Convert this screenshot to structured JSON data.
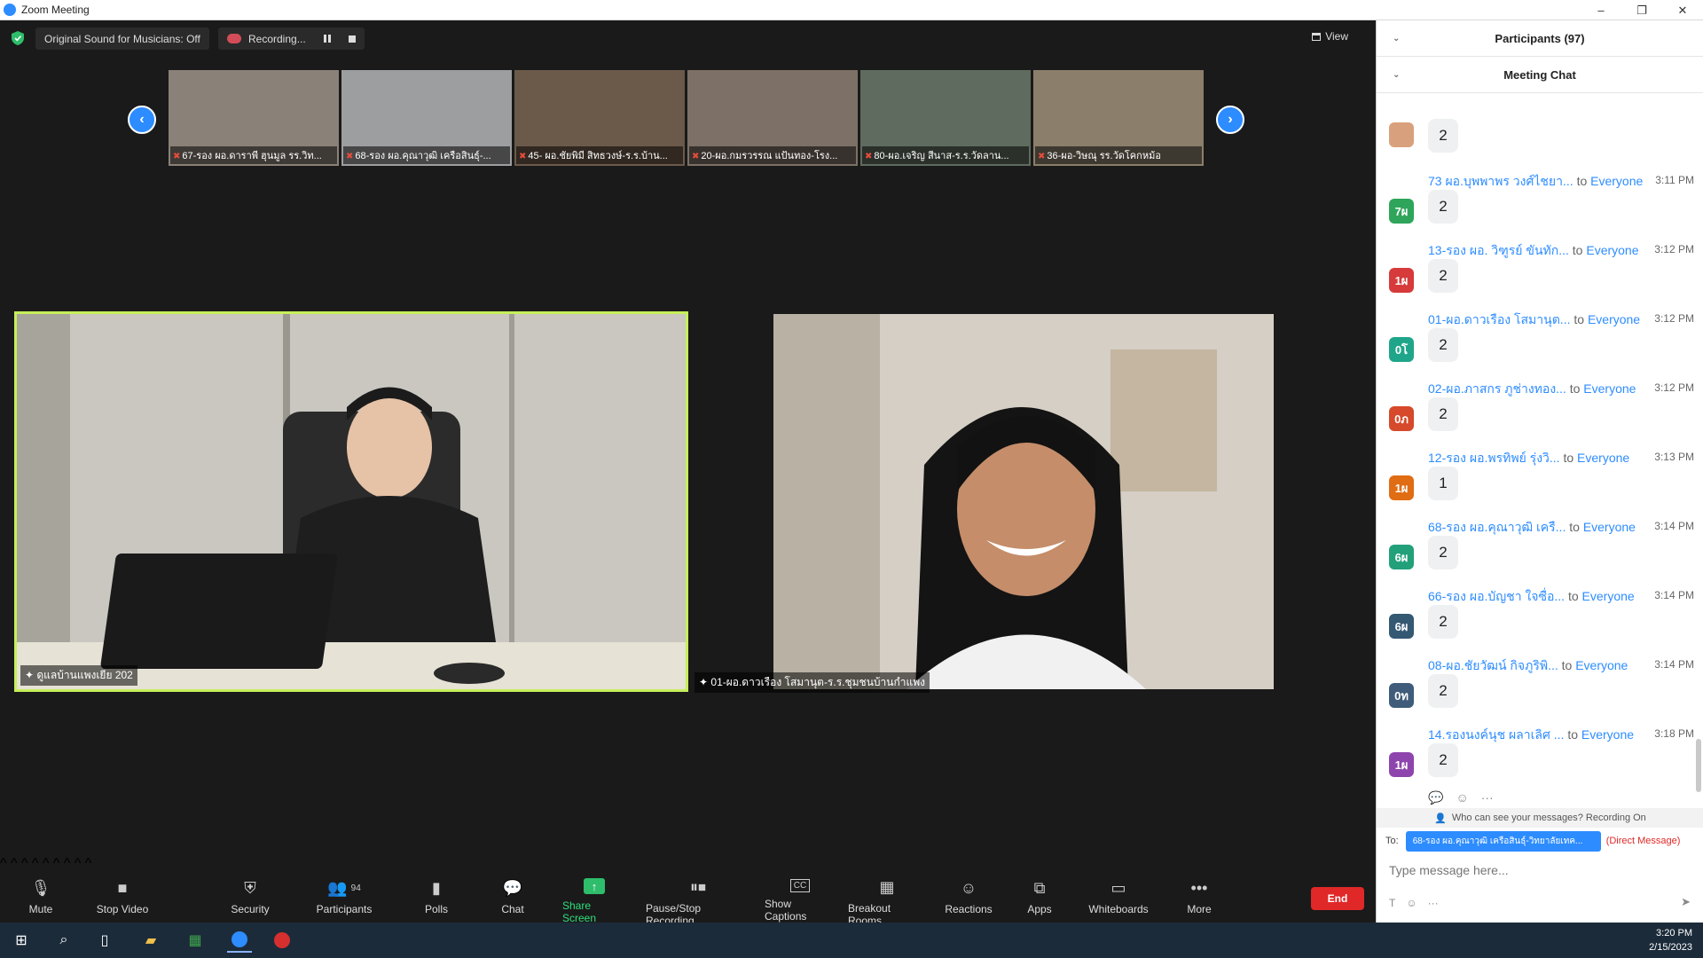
{
  "window": {
    "title": "Zoom Meeting",
    "controls": [
      "–",
      "❐",
      "✕"
    ]
  },
  "topbar": {
    "original_sound": "Original Sound for Musicians: Off",
    "recording": "Recording...",
    "view": "View"
  },
  "thumbnails": [
    {
      "name": "67-รอง ผอ.ดาราพี ฮุนมูล รร.วิท...",
      "color": "#8a8178"
    },
    {
      "name": "68-รอง ผอ.คุณาวุฒิ เครือสินธุ์-...",
      "color": "#9d9ea0"
    },
    {
      "name": "45- ผอ.ชัยพิมี สิทธวงษ์-ร.ร.บ้าน...",
      "color": "#6b5a4a"
    },
    {
      "name": "20-ผอ.กมรวรรณ แป้นทอง-โรง...",
      "color": "#7d7066"
    },
    {
      "name": "80-ผอ.เจริญ สีนาส-ร.ร.วัดลาน...",
      "color": "#5f6b5e"
    },
    {
      "name": "36-ผอ-วิษณุ รร.วัดโคกหม้อ",
      "color": "#8b7e6a"
    }
  ],
  "main_videos": {
    "main_label": "ดูแลบ้านแพงเยีย 202",
    "second_label": "01-ผอ.ดาวเรือง โสมานุต-ร.ร.ชุมชนบ้านกำแพง"
  },
  "toolbar": {
    "mute": "Mute",
    "stop_video": "Stop Video",
    "security": "Security",
    "participants": "Participants",
    "participants_count": "94",
    "polls": "Polls",
    "chat": "Chat",
    "share_screen": "Share Screen",
    "pause_stop_recording": "Pause/Stop Recording",
    "show_captions": "Show Captions",
    "breakout_rooms": "Breakout Rooms",
    "reactions": "Reactions",
    "apps": "Apps",
    "whiteboards": "Whiteboards",
    "more": "More",
    "end": "End",
    "cc_icon": "CC"
  },
  "panel": {
    "participants_header": "Participants (97)",
    "chat_header": "Meeting Chat",
    "first_message_value": "2",
    "messages": [
      {
        "sender": "73 ผอ.บุพพาพร วงศ์ไชยา...",
        "to": "to",
        "recipient": "Everyone",
        "time": "3:11 PM",
        "avatar": "7ผ",
        "avatar_color": "#2ea55a",
        "text": "2"
      },
      {
        "sender": "13-รอง ผอ. วิฑูรย์ ขันทัก...",
        "to": "to",
        "recipient": "Everyone",
        "time": "3:12 PM",
        "avatar": "1ผ",
        "avatar_color": "#d63a3a",
        "text": "2"
      },
      {
        "sender": "01-ผอ.ดาวเรือง โสมานุต...",
        "to": "to",
        "recipient": "Everyone",
        "time": "3:12 PM",
        "avatar": "0โ",
        "avatar_color": "#1fa58a",
        "text": "2"
      },
      {
        "sender": "02-ผอ.ภาสกร ภูช่างทอง...",
        "to": "to",
        "recipient": "Everyone",
        "time": "3:12 PM",
        "avatar": "0ภ",
        "avatar_color": "#d6492a",
        "text": "2"
      },
      {
        "sender": "12-รอง ผอ.พรทิพย์ รุ่งวิ...",
        "to": "to",
        "recipient": "Everyone",
        "time": "3:13 PM",
        "avatar": "1ผ",
        "avatar_color": "#e06c13",
        "text": "1"
      },
      {
        "sender": "68-รอง ผอ.คุณาวุฒิ เครื...",
        "to": "to",
        "recipient": "Everyone",
        "time": "3:14 PM",
        "avatar": "6ผ",
        "avatar_color": "#22a07a",
        "text": "2"
      },
      {
        "sender": "66-รอง ผอ.บัญชา ใจซื่อ...",
        "to": "to",
        "recipient": "Everyone",
        "time": "3:14 PM",
        "avatar": "6ผ",
        "avatar_color": "#355873",
        "text": "2"
      },
      {
        "sender": "08-ผอ.ชัยวัฒน์ กิจภูริพิ...",
        "to": "to",
        "recipient": "Everyone",
        "time": "3:14 PM",
        "avatar": "0ท",
        "avatar_color": "#3f5c7a",
        "text": "2"
      },
      {
        "sender": "14.รองนงค์นุช ผลาเลิศ ...",
        "to": "to",
        "recipient": "Everyone",
        "time": "3:18 PM",
        "avatar": "1ผ",
        "avatar_color": "#8e44ad",
        "text": "2"
      }
    ],
    "privacy_note": "Who can see your messages? Recording On",
    "to_label": "To:",
    "to_value": "68-รอง ผอ.คุณาวุฒิ เครือสินธุ์-วิทยาลัยเทค...",
    "direct_message": "(Direct Message)",
    "input_placeholder": "Type message here..."
  },
  "taskbar": {
    "time": "3:20 PM",
    "date": "2/15/2023"
  },
  "colors": {
    "accent": "#2d8cff",
    "speaker_border": "#c6ef5a",
    "end_red": "#e02828",
    "share_green": "#2ebd6b"
  }
}
